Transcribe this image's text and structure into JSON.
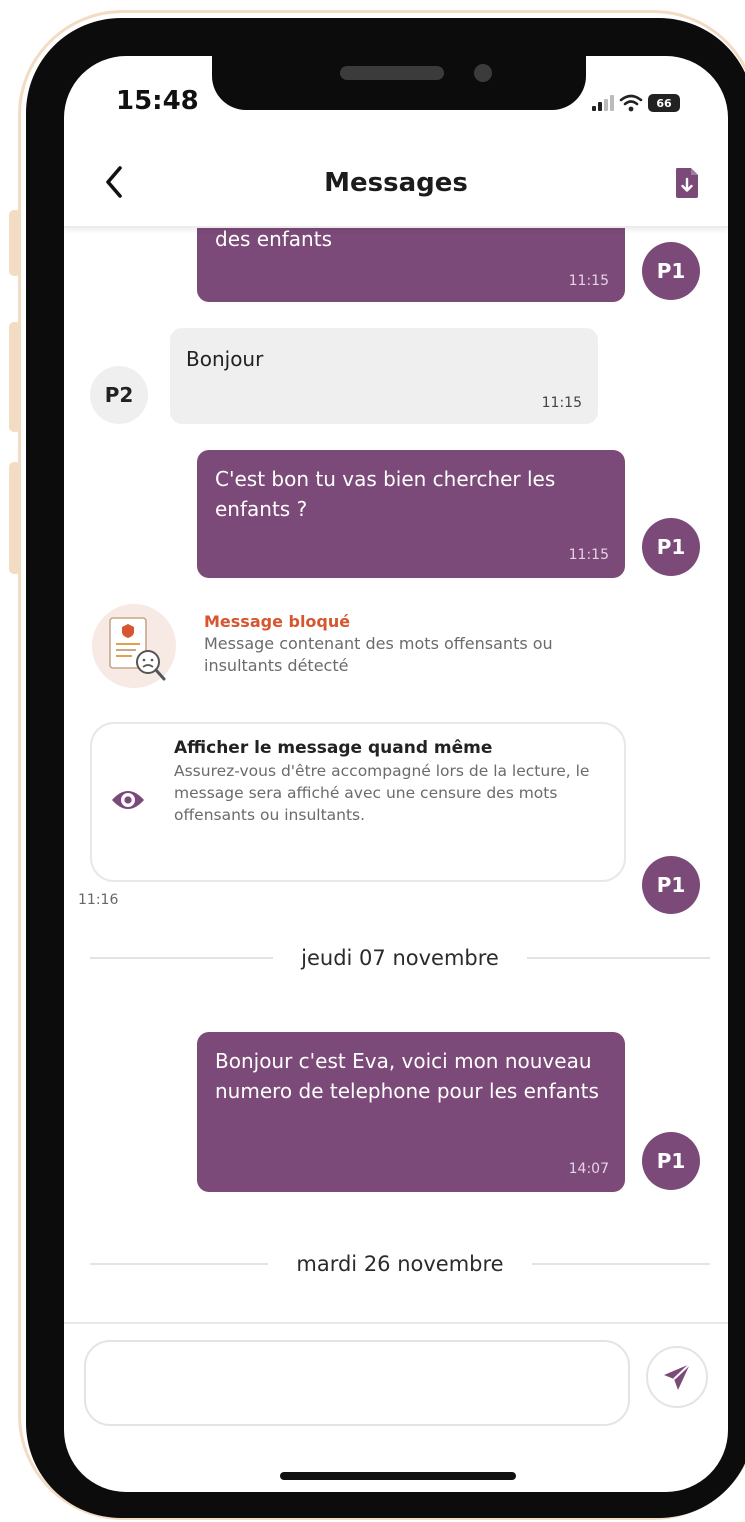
{
  "status_bar": {
    "time": "15:48",
    "battery": "66"
  },
  "header": {
    "back_icon": "chevron-left-icon",
    "title": "Messages",
    "action_icon": "file-download-icon"
  },
  "messages": [
    {
      "sender": "P1",
      "direction": "out",
      "text": "des enfants",
      "time": "11:15"
    },
    {
      "sender": "P2",
      "direction": "in",
      "text": "Bonjour",
      "time": "11:15"
    },
    {
      "sender": "P1",
      "direction": "out",
      "text": "C'est bon tu vas bien chercher les enfants ?",
      "time": "11:15"
    }
  ],
  "blocked": {
    "title": "Message bloqué",
    "description": "Message contenant des mots offensants ou insultants détecté",
    "reveal_title": "Afficher le message quand même",
    "reveal_description": "Assurez-vous d'être accompagné lors de la lecture, le message sera affiché avec une censure des mots offensants ou insultants.",
    "time": "11:16",
    "sender": "P1"
  },
  "separators": [
    "jeudi 07 novembre",
    "mardi 26 novembre"
  ],
  "message_late": {
    "sender": "P1",
    "direction": "out",
    "text": "Bonjour c'est Eva, voici mon nouveau numero de telephone pour les enfants",
    "time": "14:07"
  },
  "composer": {
    "value": "",
    "send_icon": "paper-plane-icon"
  },
  "colors": {
    "accent": "#7c4a78",
    "blocked": "#d6562f",
    "incoming": "#efefef",
    "frame": "#f3dcc4"
  }
}
